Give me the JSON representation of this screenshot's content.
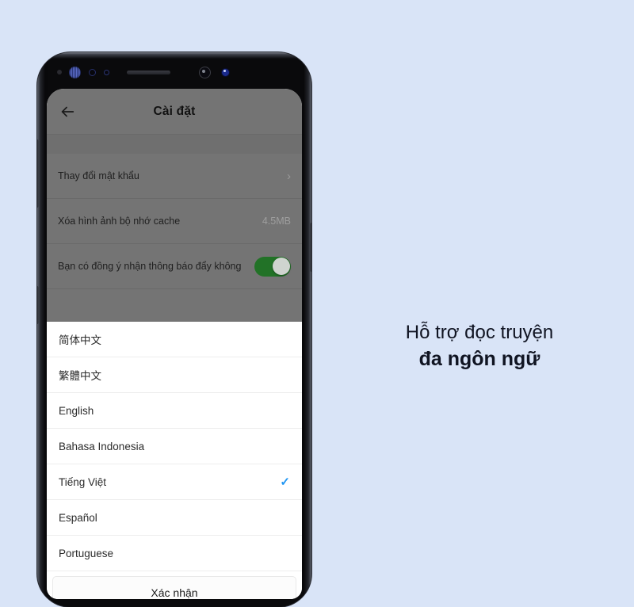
{
  "background_color": "#d9e4f7",
  "phone": {
    "notch_icons": [
      "proximity-sensor-icon",
      "iris-scanner-icon",
      "light-sensor-icon",
      "ir-sensor-icon",
      "earpiece-speaker-icon",
      "front-camera-icon",
      "status-led-icon"
    ],
    "hardware_buttons": [
      "volume-button",
      "bixby-button",
      "power-button"
    ]
  },
  "settings_screen": {
    "back_icon": "back-arrow-icon",
    "title": "Cài đặt",
    "rows": [
      {
        "label": "Thay đổi mật khẩu",
        "value": "",
        "accessory": "chevron-right-icon",
        "accessory_glyph": "›"
      },
      {
        "label": "Xóa hình ảnh bộ nhớ cache",
        "value": "4.5MB",
        "accessory": "none",
        "accessory_glyph": ""
      },
      {
        "label": "Bạn có đồng ý nhận thông báo đẩy không",
        "value": "",
        "accessory": "toggle-switch",
        "accessory_glyph": "",
        "toggle_on": true,
        "toggle_color": "#227227"
      }
    ]
  },
  "language_sheet": {
    "items": [
      {
        "label": "简体中文",
        "selected": false
      },
      {
        "label": "繁體中文",
        "selected": false
      },
      {
        "label": "English",
        "selected": false
      },
      {
        "label": "Bahasa Indonesia",
        "selected": false
      },
      {
        "label": "Tiếng Việt",
        "selected": true
      },
      {
        "label": "Español",
        "selected": false
      },
      {
        "label": "Portuguese",
        "selected": false
      }
    ],
    "check_glyph": "✓",
    "check_color": "#2196f3",
    "confirm_label": "Xác nhận"
  },
  "caption": {
    "line1": "Hỗ trợ đọc truyện",
    "line2": "đa ngôn ngữ"
  }
}
